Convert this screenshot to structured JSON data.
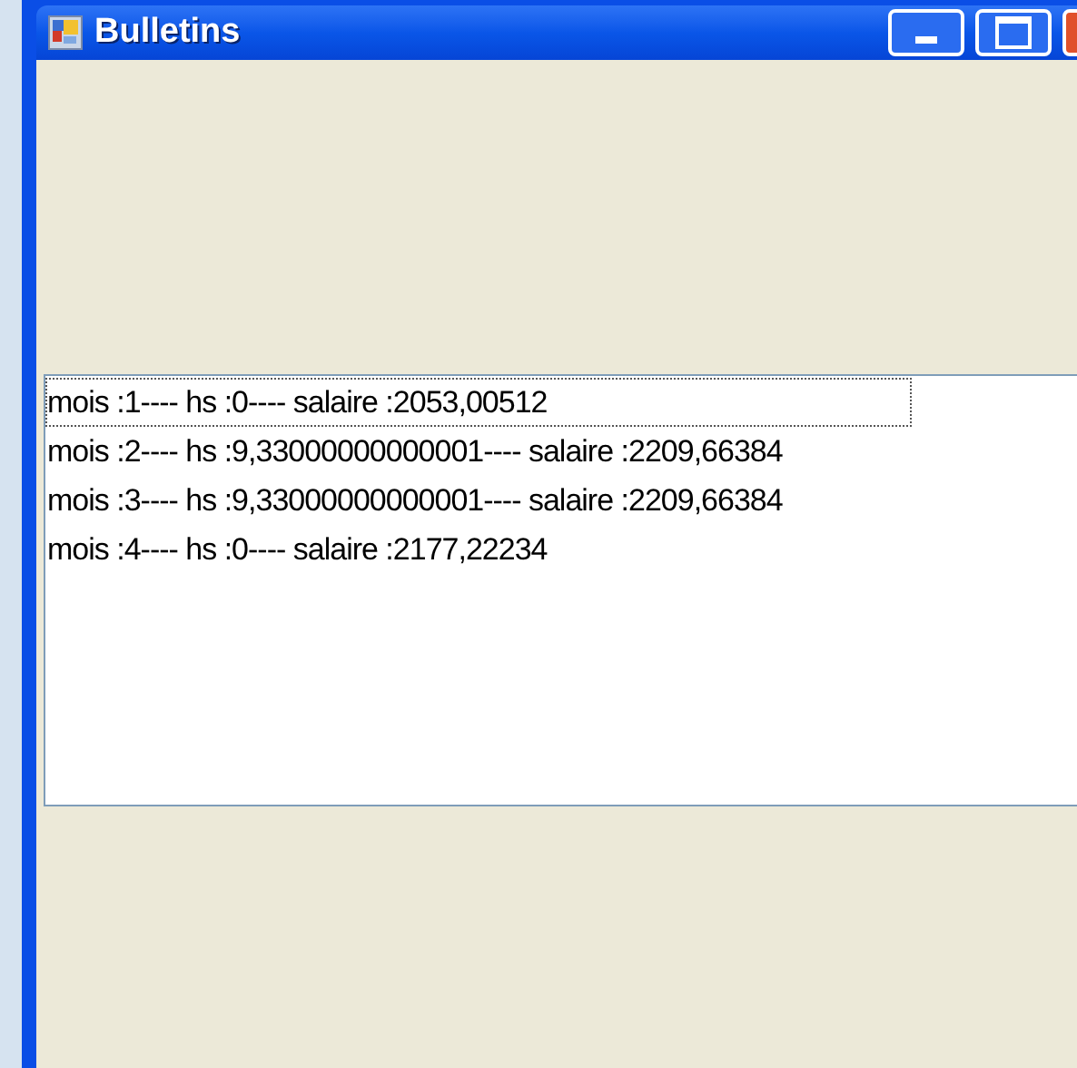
{
  "window": {
    "title": "Bulletins"
  },
  "list": {
    "items": [
      {
        "text": "mois :1---- hs :0---- salaire :2053,00512",
        "focused": true
      },
      {
        "text": "mois :2---- hs :9,33000000000001---- salaire :2209,66384",
        "focused": false
      },
      {
        "text": "mois :3---- hs :9,33000000000001---- salaire :2209,66384",
        "focused": false
      },
      {
        "text": "mois :4---- hs :0---- salaire :2177,22234",
        "focused": false
      }
    ]
  }
}
